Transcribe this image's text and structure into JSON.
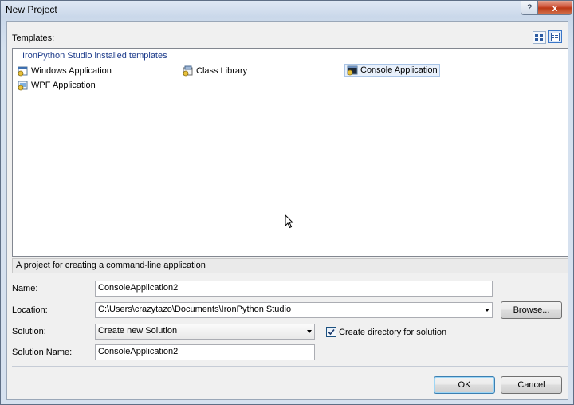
{
  "window": {
    "title": "New Project",
    "help_label": "?",
    "close_label": "x"
  },
  "templates": {
    "label": "Templates:",
    "group_header": "IronPython Studio installed templates",
    "items": [
      {
        "label": "Windows Application",
        "icon": "windows-app-icon"
      },
      {
        "label": "Class Library",
        "icon": "class-library-icon"
      },
      {
        "label": "Console Application",
        "icon": "console-app-icon",
        "selected": true
      },
      {
        "label": "WPF Application",
        "icon": "wpf-app-icon"
      }
    ]
  },
  "description": "A project for creating a command-line application",
  "form": {
    "name_label": "Name:",
    "name_value": "ConsoleApplication2",
    "location_label": "Location:",
    "location_value": "C:\\Users\\crazytazo\\Documents\\IronPython Studio",
    "browse_label": "Browse...",
    "solution_label": "Solution:",
    "solution_value": "Create new Solution",
    "create_dir_label": "Create directory for solution",
    "create_dir_checked": true,
    "solution_name_label": "Solution Name:",
    "solution_name_value": "ConsoleApplication2"
  },
  "buttons": {
    "ok": "OK",
    "cancel": "Cancel"
  }
}
